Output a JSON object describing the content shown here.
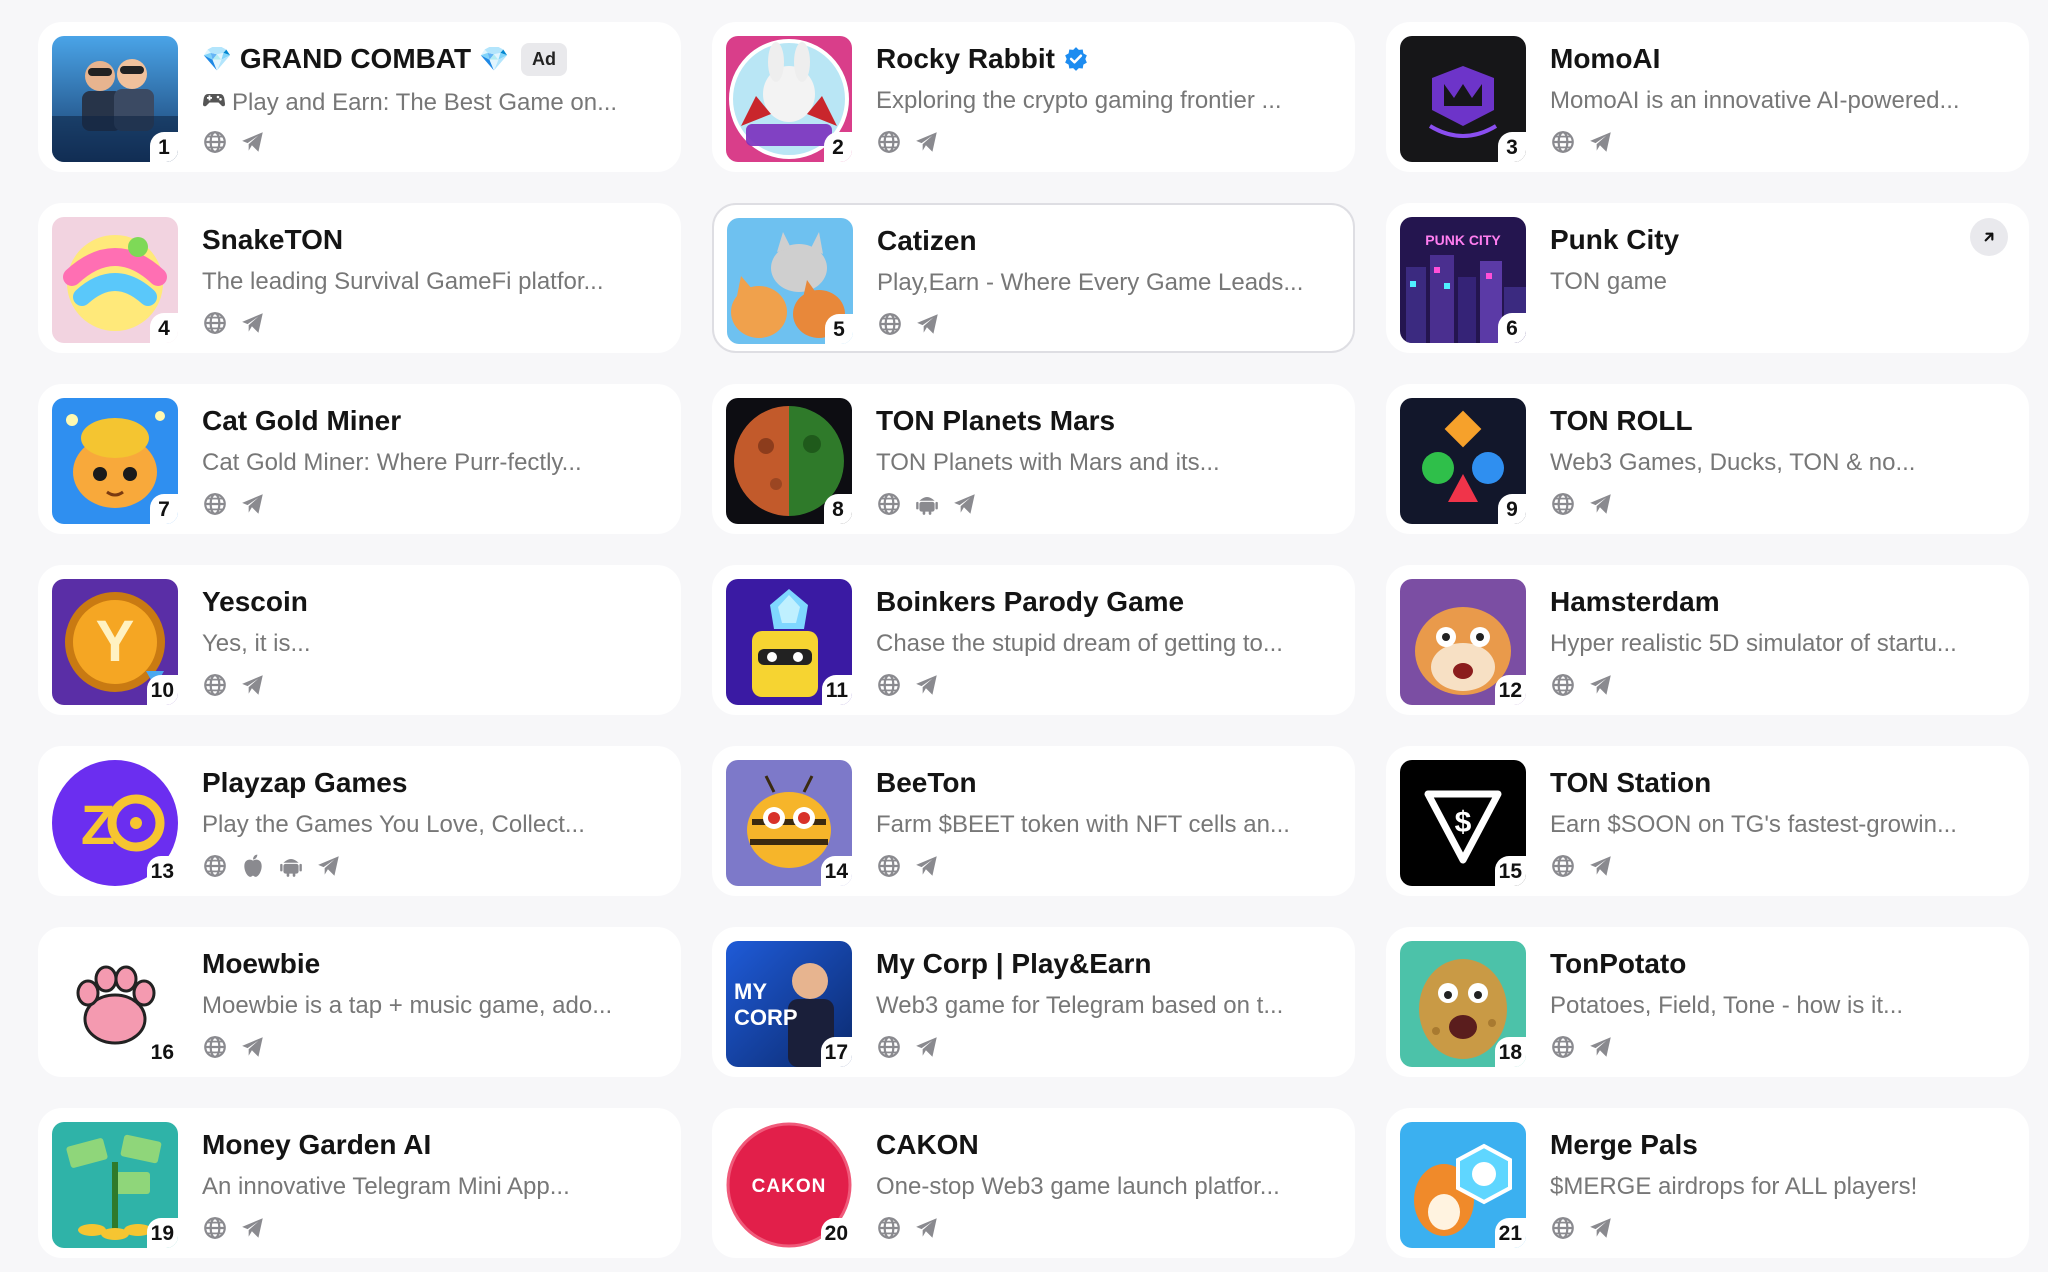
{
  "apps": [
    {
      "rank": "1",
      "name": "GRAND COMBAT",
      "desc": "Play and Earn: The Best Game on...",
      "ad": "Ad",
      "gems": true,
      "desc_icon": "gamepad",
      "thumb": "grand",
      "platforms": [
        "web",
        "telegram"
      ]
    },
    {
      "rank": "2",
      "name": "Rocky Rabbit",
      "desc": "Exploring the crypto gaming frontier ...",
      "verified": true,
      "thumb": "rocky",
      "platforms": [
        "web",
        "telegram"
      ]
    },
    {
      "rank": "3",
      "name": "MomoAI",
      "desc": "MomoAI is an innovative AI-powered...",
      "thumb": "momo",
      "platforms": [
        "web",
        "telegram"
      ]
    },
    {
      "rank": "4",
      "name": "SnakeTON",
      "desc": "The leading Survival GameFi platfor...",
      "thumb": "snake",
      "platforms": [
        "web",
        "telegram"
      ]
    },
    {
      "rank": "5",
      "name": "Catizen",
      "desc": "Play,Earn - Where Every Game Leads...",
      "thumb": "catizen",
      "selected": true,
      "platforms": [
        "web",
        "telegram"
      ]
    },
    {
      "rank": "6",
      "name": "Punk City",
      "desc": "TON game",
      "thumb": "punk",
      "external": true,
      "platforms": []
    },
    {
      "rank": "7",
      "name": "Cat Gold Miner",
      "desc": "Cat Gold Miner: Where Purr-fectly...",
      "thumb": "catgold",
      "platforms": [
        "web",
        "telegram"
      ]
    },
    {
      "rank": "8",
      "name": "TON Planets Mars",
      "desc": "TON Planets with Mars and its...",
      "thumb": "mars",
      "platforms": [
        "web",
        "android",
        "telegram"
      ]
    },
    {
      "rank": "9",
      "name": "TON ROLL",
      "desc": "Web3 Games, Ducks, TON & no...",
      "thumb": "tonroll",
      "platforms": [
        "web",
        "telegram"
      ]
    },
    {
      "rank": "10",
      "name": "Yescoin",
      "desc": "Yes, it is...",
      "thumb": "yescoin",
      "platforms": [
        "web",
        "telegram"
      ]
    },
    {
      "rank": "11",
      "name": "Boinkers Parody Game",
      "desc": "Chase the stupid dream of getting to...",
      "thumb": "boinkers",
      "platforms": [
        "web",
        "telegram"
      ]
    },
    {
      "rank": "12",
      "name": "Hamsterdam",
      "desc": "Hyper realistic 5D simulator of startu...",
      "thumb": "hamster",
      "platforms": [
        "web",
        "telegram"
      ]
    },
    {
      "rank": "13",
      "name": "Playzap Games",
      "desc": "Play the Games You Love, Collect...",
      "thumb": "playzap",
      "platforms": [
        "web",
        "apple",
        "android",
        "telegram"
      ]
    },
    {
      "rank": "14",
      "name": "BeeTon",
      "desc": "Farm $BEET token with NFT cells an...",
      "thumb": "beeton",
      "platforms": [
        "web",
        "telegram"
      ]
    },
    {
      "rank": "15",
      "name": "TON Station",
      "desc": "Earn $SOON on TG's fastest-growin...",
      "thumb": "tonstation",
      "platforms": [
        "web",
        "telegram"
      ]
    },
    {
      "rank": "16",
      "name": "Moewbie",
      "desc": "Moewbie is a tap + music game, ado...",
      "thumb": "moewbie",
      "platforms": [
        "web",
        "telegram"
      ]
    },
    {
      "rank": "17",
      "name": "My Corp | Play&Earn",
      "desc": "Web3 game for Telegram based on t...",
      "thumb": "mycorp",
      "thumb_text": "MY CORP",
      "platforms": [
        "web",
        "telegram"
      ]
    },
    {
      "rank": "18",
      "name": "TonPotato",
      "desc": "Potatoes, Field, Tone - how is it...",
      "thumb": "potato",
      "platforms": [
        "web",
        "telegram"
      ]
    },
    {
      "rank": "19",
      "name": "Money Garden AI",
      "desc": "An innovative Telegram Mini App...",
      "thumb": "money",
      "platforms": [
        "web",
        "telegram"
      ]
    },
    {
      "rank": "20",
      "name": "CAKON",
      "desc": "One-stop Web3 game launch platfor...",
      "thumb": "cakon",
      "thumb_text": "CAKON",
      "platforms": [
        "web",
        "telegram"
      ]
    },
    {
      "rank": "21",
      "name": "Merge Pals",
      "desc": "$MERGE airdrops for ALL players!",
      "thumb": "mergepals",
      "platforms": [
        "web",
        "telegram"
      ]
    }
  ]
}
